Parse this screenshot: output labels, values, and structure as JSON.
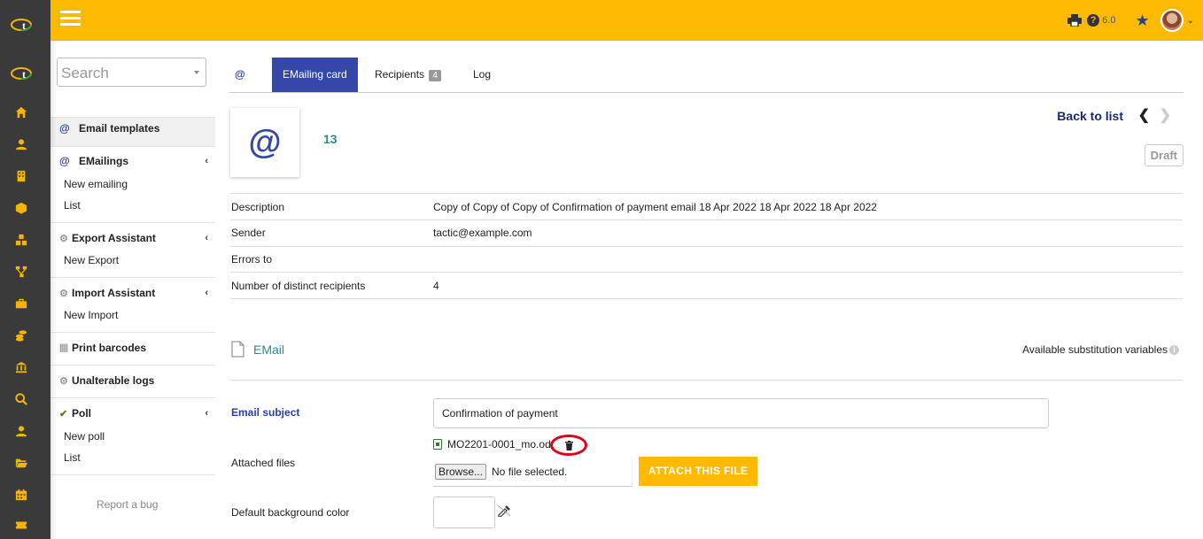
{
  "topbar": {
    "version": "6.0"
  },
  "search": {
    "placeholder": "Search"
  },
  "leftmenu": {
    "email_templates": "Email templates",
    "emailings": {
      "title": "EMailings",
      "items": [
        "New emailing",
        "List"
      ]
    },
    "export": {
      "title": "Export Assistant",
      "items": [
        "New Export"
      ]
    },
    "import": {
      "title": "Import Assistant",
      "items": [
        "New Import"
      ]
    },
    "print_barcodes": "Print barcodes",
    "unalterable_logs": "Unalterable logs",
    "poll": {
      "title": "Poll",
      "items": [
        "New poll",
        "List"
      ]
    },
    "report_bug": "Report a bug"
  },
  "tabs": {
    "at": "@",
    "card": "EMailing card",
    "recipients": "Recipients",
    "recipients_count": "4",
    "log": "Log"
  },
  "card": {
    "icon": "@",
    "ref": "13",
    "back_to_list": "Back to list",
    "status": "Draft"
  },
  "fields": [
    {
      "label": "Description",
      "value": "Copy of Copy of Copy of Confirmation of payment email 18 Apr 2022 18 Apr 2022 18 Apr 2022"
    },
    {
      "label": "Sender",
      "value": "tactic@example.com"
    },
    {
      "label": "Errors to",
      "value": ""
    },
    {
      "label": "Number of distinct recipients",
      "value": "4"
    }
  ],
  "email": {
    "section_title": "EMail",
    "available_vars": "Available substitution variables",
    "subject_label": "Email subject",
    "subject_value": "Confirmation of payment",
    "attached_label": "Attached files",
    "attached_file": "MO2201-0001_mo.odt",
    "browse_label": "Browse...",
    "no_file": "No file selected.",
    "attach_button": "ATTACH THIS FILE",
    "bg_color_label": "Default background color"
  },
  "colors": {
    "topbar": "#fdba00",
    "iconbar": "#3a3a3a",
    "active_tab": "#3547a8",
    "teal": "#2a8c8c"
  }
}
